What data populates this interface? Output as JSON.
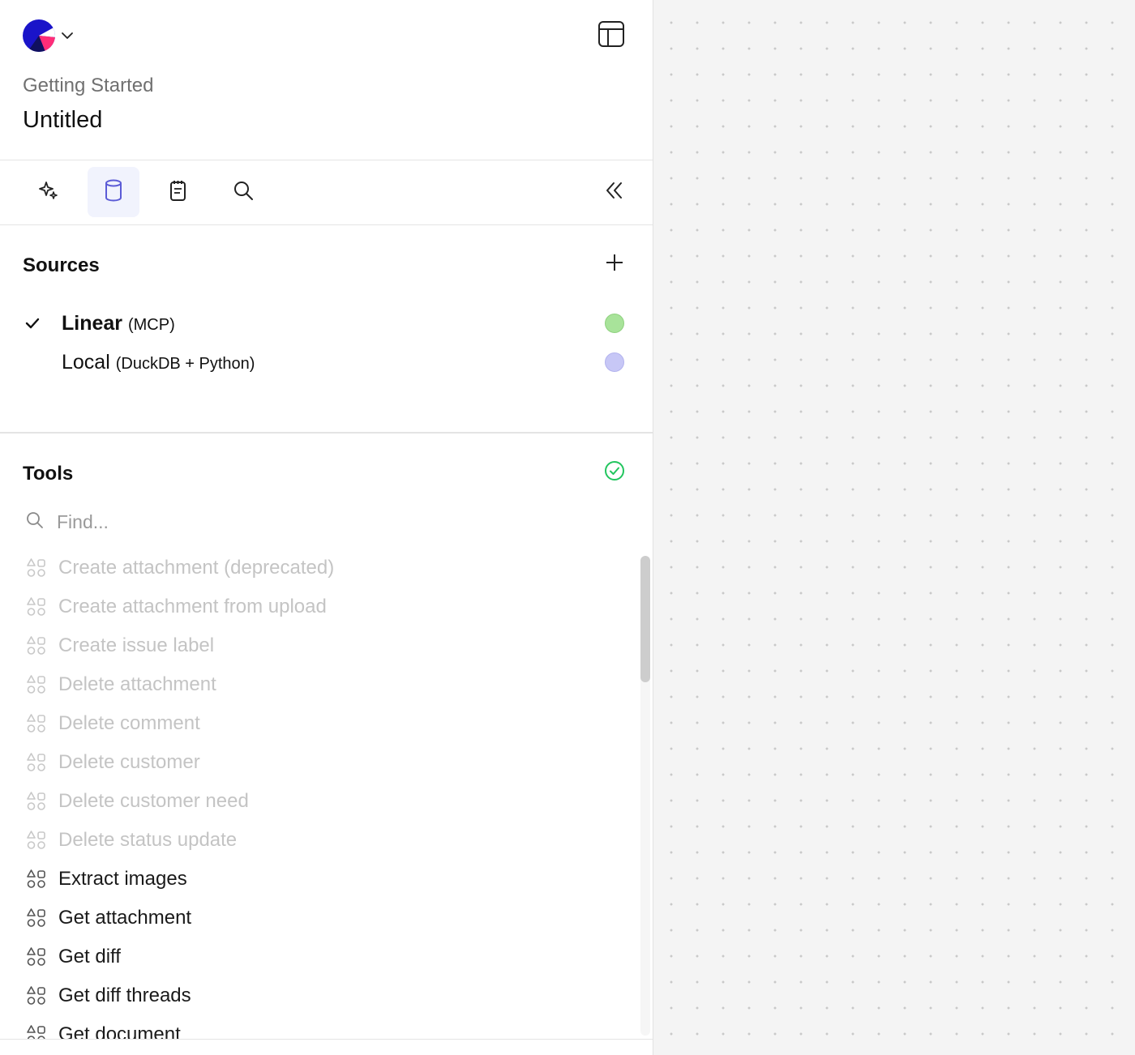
{
  "header": {
    "breadcrumb": "Getting Started",
    "title": "Untitled"
  },
  "toolbar": {
    "tabs": [
      {
        "icon": "sparkles-icon",
        "active": false
      },
      {
        "icon": "database-icon",
        "active": true
      },
      {
        "icon": "notebook-icon",
        "active": false
      },
      {
        "icon": "search-icon",
        "active": false
      }
    ],
    "collapse_icon": "double-chevron-left-icon"
  },
  "sources": {
    "title": "Sources",
    "items": [
      {
        "name": "Linear",
        "detail": "(MCP)",
        "selected": true,
        "status_color": "#a8e39a"
      },
      {
        "name": "Local",
        "detail": "(DuckDB + Python)",
        "selected": false,
        "status_color": "#c7c7f6"
      }
    ]
  },
  "tools": {
    "title": "Tools",
    "status_icon": "check-circle-icon",
    "status_color": "#22c55e",
    "search_placeholder": "Find...",
    "items": [
      {
        "label": "Create attachment (deprecated)",
        "enabled": false
      },
      {
        "label": "Create attachment from upload",
        "enabled": false
      },
      {
        "label": "Create issue label",
        "enabled": false
      },
      {
        "label": "Delete attachment",
        "enabled": false
      },
      {
        "label": "Delete comment",
        "enabled": false
      },
      {
        "label": "Delete customer",
        "enabled": false
      },
      {
        "label": "Delete customer need",
        "enabled": false
      },
      {
        "label": "Delete status update",
        "enabled": false
      },
      {
        "label": "Extract images",
        "enabled": true
      },
      {
        "label": "Get attachment",
        "enabled": true
      },
      {
        "label": "Get diff",
        "enabled": true
      },
      {
        "label": "Get diff threads",
        "enabled": true
      },
      {
        "label": "Get document",
        "enabled": true
      }
    ]
  },
  "colors": {
    "accent": "#5b5bd6",
    "canvas": "#f4f4f4"
  }
}
